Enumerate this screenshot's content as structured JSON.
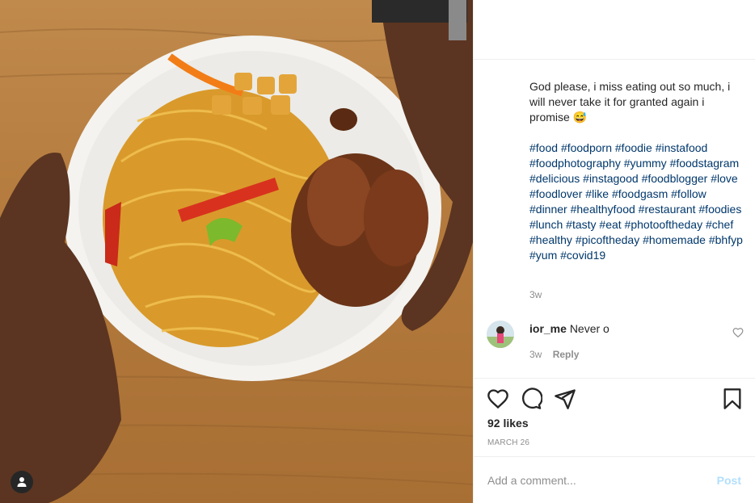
{
  "post": {
    "caption_text": "God please, i miss eating out so much, i will never take it for granted again i promise 😅",
    "hashtags": [
      "#food",
      "#foodporn",
      "#foodie",
      "#instafood",
      "#foodphotography",
      "#yummy",
      "#foodstagram",
      "#delicious",
      "#instagood",
      "#foodblogger",
      "#love",
      "#foodlover",
      "#like",
      "#foodgasm",
      "#follow",
      "#dinner",
      "#healthyfood",
      "#restaurant",
      "#foodies",
      "#lunch",
      "#tasty",
      "#eat",
      "#photooftheday",
      "#chef",
      "#healthy",
      "#picoftheday",
      "#homemade",
      "#bhfyp",
      "#yum",
      "#covid19"
    ],
    "caption_time": "3w",
    "likes": "92 likes",
    "date": "MARCH 26"
  },
  "comment": {
    "username": "ior_me",
    "text": "Never o",
    "time": "3w",
    "reply_label": "Reply"
  },
  "composer": {
    "placeholder": "Add a comment...",
    "post_label": "Post"
  },
  "icons": {
    "like": "heart-icon",
    "comment": "comment-icon",
    "share": "share-icon",
    "save": "bookmark-icon",
    "tagged_users": "user-icon",
    "comment_like": "heart-icon"
  },
  "colors": {
    "hashtag": "#00376b",
    "muted": "#8e8e8e",
    "post_disabled": "#b2dffc"
  }
}
